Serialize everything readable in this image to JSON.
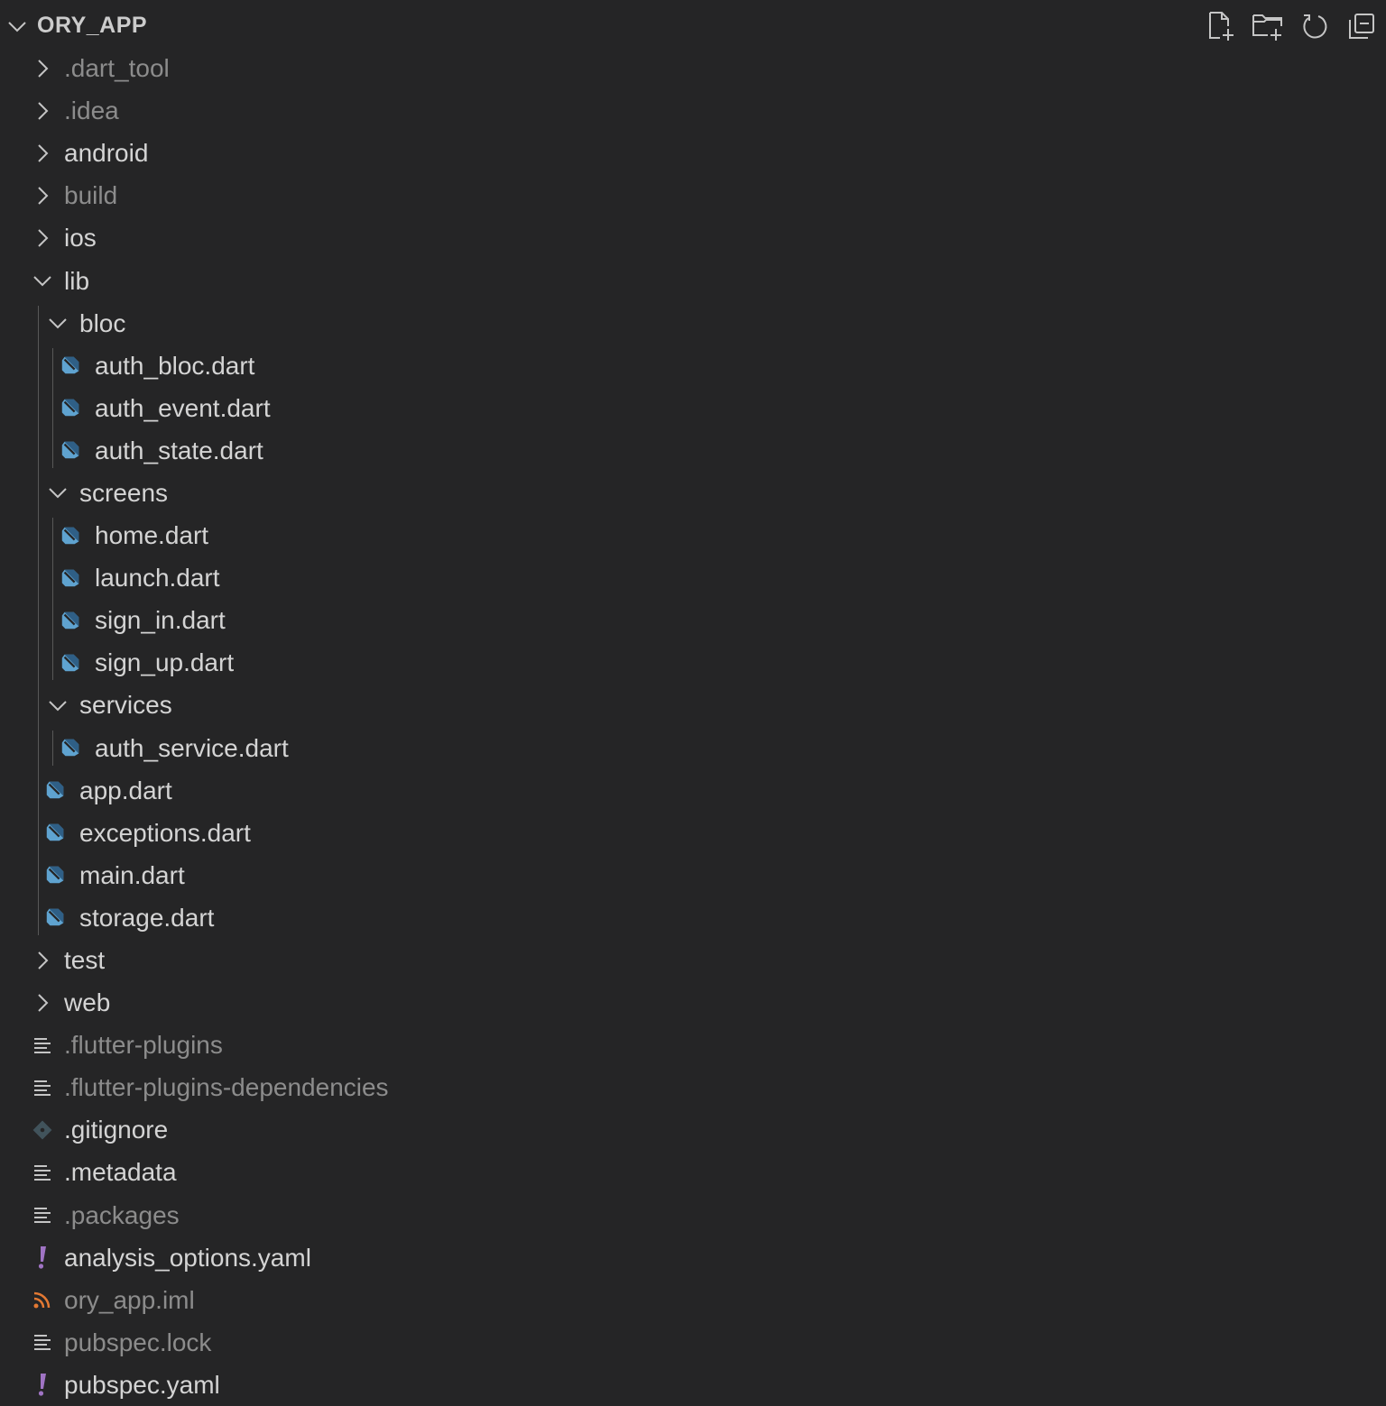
{
  "explorer": {
    "title": "ORY_APP",
    "actions": [
      {
        "name": "new-file-button",
        "icon": "new-file-icon"
      },
      {
        "name": "new-folder-button",
        "icon": "new-folder-icon"
      },
      {
        "name": "refresh-explorer-button",
        "icon": "refresh-icon"
      },
      {
        "name": "collapse-folders-button",
        "icon": "collapse-all-icon"
      }
    ]
  },
  "colors": {
    "background": "#252526",
    "text": "#d4d4d4",
    "ignored_text": "#8c8c8c",
    "dart_icon": "#5fa3d0",
    "yaml_icon": "#a074c4",
    "rss_icon": "#e37933",
    "git_icon": "#41535b"
  },
  "tree": [
    {
      "label": ".dart_tool",
      "type": "folder",
      "expanded": false,
      "depth": 1,
      "dim": true
    },
    {
      "label": ".idea",
      "type": "folder",
      "expanded": false,
      "depth": 1,
      "dim": true
    },
    {
      "label": "android",
      "type": "folder",
      "expanded": false,
      "depth": 1,
      "dim": false
    },
    {
      "label": "build",
      "type": "folder",
      "expanded": false,
      "depth": 1,
      "dim": true
    },
    {
      "label": "ios",
      "type": "folder",
      "expanded": false,
      "depth": 1,
      "dim": false
    },
    {
      "label": "lib",
      "type": "folder",
      "expanded": true,
      "depth": 1,
      "dim": false
    },
    {
      "label": "bloc",
      "type": "folder",
      "expanded": true,
      "depth": 2,
      "dim": false
    },
    {
      "label": "auth_bloc.dart",
      "type": "dart",
      "depth": 3,
      "dim": false
    },
    {
      "label": "auth_event.dart",
      "type": "dart",
      "depth": 3,
      "dim": false
    },
    {
      "label": "auth_state.dart",
      "type": "dart",
      "depth": 3,
      "dim": false
    },
    {
      "label": "screens",
      "type": "folder",
      "expanded": true,
      "depth": 2,
      "dim": false
    },
    {
      "label": "home.dart",
      "type": "dart",
      "depth": 3,
      "dim": false
    },
    {
      "label": "launch.dart",
      "type": "dart",
      "depth": 3,
      "dim": false
    },
    {
      "label": "sign_in.dart",
      "type": "dart",
      "depth": 3,
      "dim": false
    },
    {
      "label": "sign_up.dart",
      "type": "dart",
      "depth": 3,
      "dim": false
    },
    {
      "label": "services",
      "type": "folder",
      "expanded": true,
      "depth": 2,
      "dim": false
    },
    {
      "label": "auth_service.dart",
      "type": "dart",
      "depth": 3,
      "dim": false
    },
    {
      "label": "app.dart",
      "type": "dart",
      "depth": 2,
      "dim": false
    },
    {
      "label": "exceptions.dart",
      "type": "dart",
      "depth": 2,
      "dim": false
    },
    {
      "label": "main.dart",
      "type": "dart",
      "depth": 2,
      "dim": false
    },
    {
      "label": "storage.dart",
      "type": "dart",
      "depth": 2,
      "dim": false
    },
    {
      "label": "test",
      "type": "folder",
      "expanded": false,
      "depth": 1,
      "dim": false
    },
    {
      "label": "web",
      "type": "folder",
      "expanded": false,
      "depth": 1,
      "dim": false
    },
    {
      "label": ".flutter-plugins",
      "type": "text",
      "depth": 1,
      "dim": true
    },
    {
      "label": ".flutter-plugins-dependencies",
      "type": "text",
      "depth": 1,
      "dim": true
    },
    {
      "label": ".gitignore",
      "type": "git",
      "depth": 1,
      "dim": false
    },
    {
      "label": ".metadata",
      "type": "text",
      "depth": 1,
      "dim": false
    },
    {
      "label": ".packages",
      "type": "text",
      "depth": 1,
      "dim": true
    },
    {
      "label": "analysis_options.yaml",
      "type": "yaml",
      "depth": 1,
      "dim": false
    },
    {
      "label": "ory_app.iml",
      "type": "rss",
      "depth": 1,
      "dim": true
    },
    {
      "label": "pubspec.lock",
      "type": "text",
      "depth": 1,
      "dim": true
    },
    {
      "label": "pubspec.yaml",
      "type": "yaml",
      "depth": 1,
      "dim": false
    }
  ]
}
